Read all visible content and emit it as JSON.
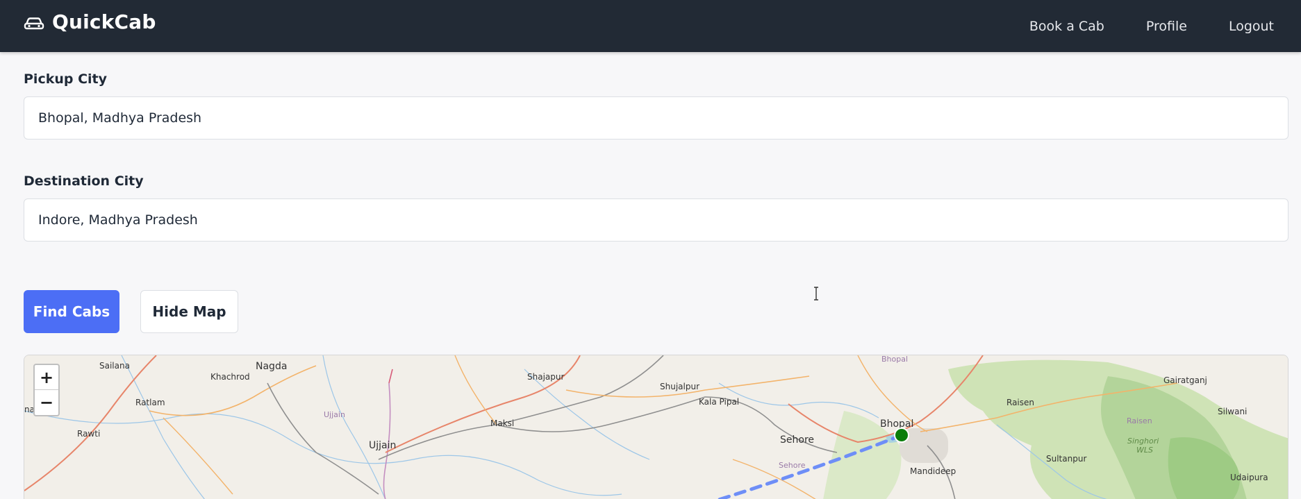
{
  "navbar": {
    "brand": "QuickCab",
    "brand_icon": "car-icon",
    "links": [
      "Book a Cab",
      "Profile",
      "Logout"
    ],
    "background": "#222a35"
  },
  "form": {
    "pickup_label": "Pickup City",
    "pickup_value": "Bhopal, Madhya Pradesh",
    "destination_label": "Destination City",
    "destination_value": "Indore, Madhya Pradesh"
  },
  "actions": {
    "find_label": "Find Cabs",
    "hide_map_label": "Hide Map",
    "accent": "#4c6ef5"
  },
  "map": {
    "zoom_in": "+",
    "zoom_out": "−",
    "places": {
      "sailana": "Sailana",
      "nagda": "Nagda",
      "khachrod": "Khachrod",
      "ratlam": "Ratlam",
      "rawti": "Rawti",
      "na": "na",
      "ujjain_region": "Ujjain",
      "ujjain": "Ujjain",
      "shajapur": "Shajapur",
      "maksi": "Maksi",
      "shujalpur": "Shujalpur",
      "kala_pipal": "Kala Pipal",
      "sehore": "Sehore",
      "sehore_region": "Sehore",
      "bhopal_region": "Bhopal",
      "bhopal": "Bhopal",
      "mandideep": "Mandideep",
      "raisen": "Raisen",
      "raisen_region": "Raisen",
      "gairatganj": "Gairatganj",
      "silwani": "Silwani",
      "singhori_wls_1": "Singhori",
      "singhori_wls_2": "WLS",
      "sultanpur": "Sultanpur",
      "udaipura": "Udaipura"
    },
    "route_color": "#6e8ef7",
    "marker_color": "#0a7d0a"
  }
}
